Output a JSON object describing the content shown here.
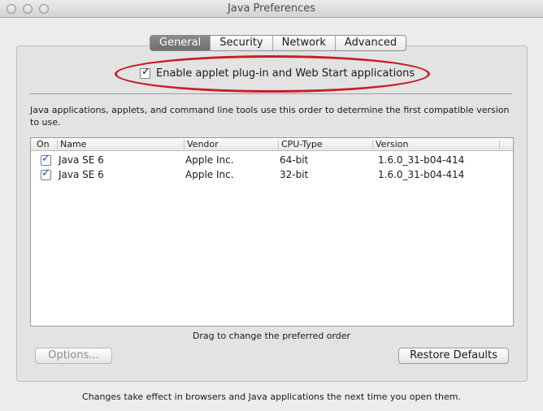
{
  "window": {
    "title": "Java Preferences"
  },
  "tabs": [
    {
      "label": "General",
      "selected": true
    },
    {
      "label": "Security",
      "selected": false
    },
    {
      "label": "Network",
      "selected": false
    },
    {
      "label": "Advanced",
      "selected": false
    }
  ],
  "general": {
    "enable_applet_label": "Enable applet plug-in and Web Start applications",
    "enable_applet_checked": true,
    "description": "Java applications, applets, and command line tools use this order to determine the first compatible version to use.",
    "table": {
      "headers": [
        "On",
        "Name",
        "Vendor",
        "CPU-Type",
        "Version"
      ],
      "rows": [
        {
          "on": true,
          "name": "Java SE 6",
          "vendor": "Apple Inc.",
          "cpu": "64-bit",
          "version": "1.6.0_31-b04-414"
        },
        {
          "on": true,
          "name": "Java SE 6",
          "vendor": "Apple Inc.",
          "cpu": "32-bit",
          "version": "1.6.0_31-b04-414"
        }
      ]
    },
    "drag_hint": "Drag to change the preferred order",
    "options_button": "Options...",
    "restore_button": "Restore Defaults"
  },
  "footer_note": "Changes take effect in browsers and Java applications the next time you open them.",
  "colors": {
    "annotation_ellipse": "#c81e25",
    "selected_tab": "#7a7a7a",
    "checkbox_blue": "#1d4fb6"
  }
}
